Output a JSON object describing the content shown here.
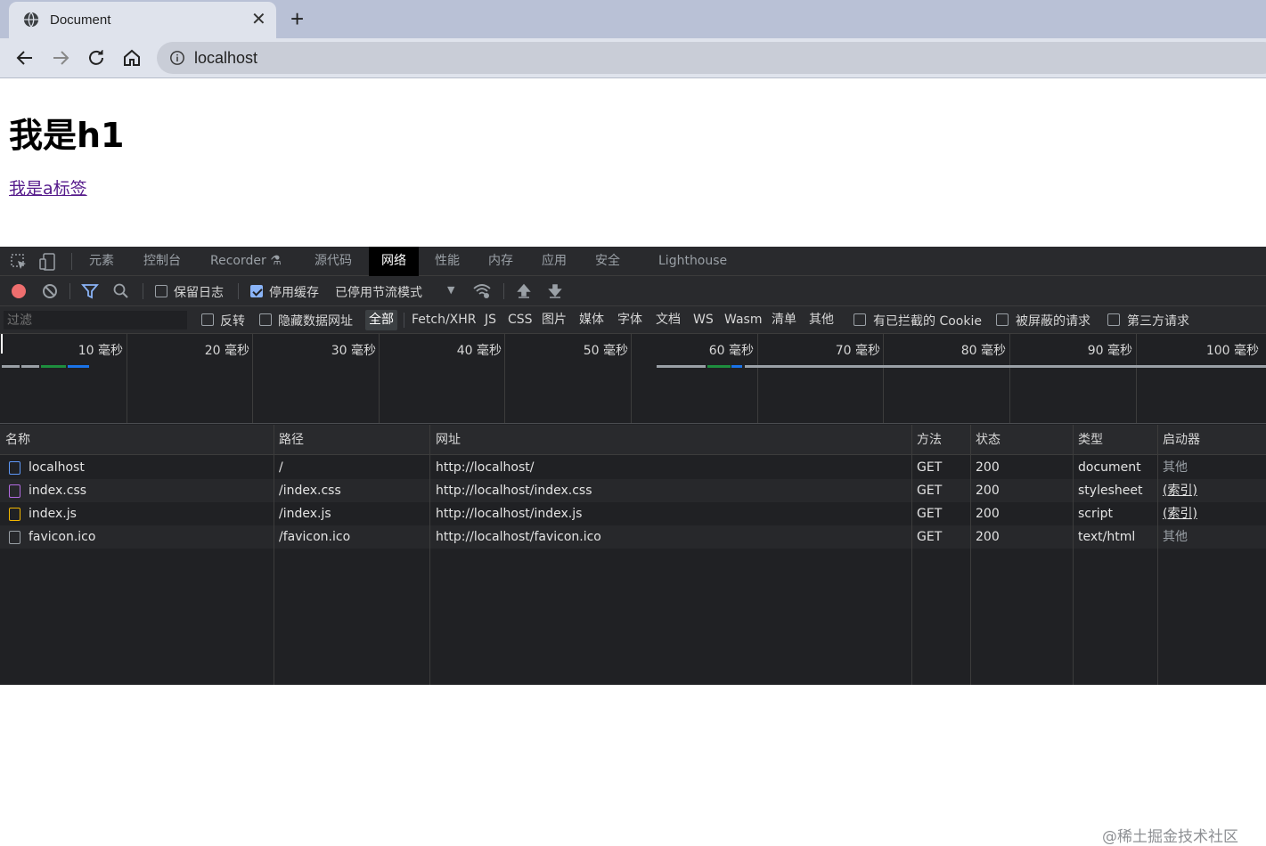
{
  "browser": {
    "tab_title": "Document",
    "tab_close": "✕",
    "new_tab": "+",
    "url": "localhost"
  },
  "page": {
    "heading": "我是h1",
    "link": "我是a标签"
  },
  "devtools": {
    "tabs": [
      "元素",
      "控制台",
      "Recorder ⚗",
      "源代码",
      "网络",
      "性能",
      "内存",
      "应用",
      "安全",
      "Lighthouse"
    ],
    "active_tab": "网络",
    "toolbar": {
      "preserve_log": "保留日志",
      "disable_cache": "停用缓存",
      "throttle": "已停用节流模式",
      "throttle_arrow": "▼"
    },
    "filter": {
      "placeholder": "过滤",
      "invert": "反转",
      "hide_data_urls": "隐藏数据网址",
      "types": [
        "全部",
        "Fetch/XHR",
        "JS",
        "CSS",
        "图片",
        "媒体",
        "字体",
        "文档",
        "WS",
        "Wasm",
        "清单",
        "其他"
      ],
      "active_type": "全部",
      "blocked_cookies": "有已拦截的 Cookie",
      "blocked_requests": "被屏蔽的请求",
      "third_party": "第三方请求"
    },
    "timeline_ticks": [
      "10 毫秒",
      "20 毫秒",
      "30 毫秒",
      "40 毫秒",
      "50 毫秒",
      "60 毫秒",
      "70 毫秒",
      "80 毫秒",
      "90 毫秒",
      "100 毫秒"
    ],
    "table": {
      "headers": [
        "名称",
        "路径",
        "网址",
        "方法",
        "状态",
        "类型",
        "启动器"
      ],
      "rows": [
        {
          "name": "localhost",
          "path": "/",
          "url": "http://localhost/",
          "method": "GET",
          "status": "200",
          "type": "document",
          "initiator": "其他",
          "icon": "document-icon",
          "icon_color": "#5e97f6"
        },
        {
          "name": "index.css",
          "path": "/index.css",
          "url": "http://localhost/index.css",
          "method": "GET",
          "status": "200",
          "type": "stylesheet",
          "initiator": "(索引)",
          "icon": "stylesheet-icon",
          "icon_color": "#b26be0"
        },
        {
          "name": "index.js",
          "path": "/index.js",
          "url": "http://localhost/index.js",
          "method": "GET",
          "status": "200",
          "type": "script",
          "initiator": "(索引)",
          "icon": "script-icon",
          "icon_color": "#f2b600"
        },
        {
          "name": "favicon.ico",
          "path": "/favicon.ico",
          "url": "http://localhost/favicon.ico",
          "method": "GET",
          "status": "200",
          "type": "text/html",
          "initiator": "其他",
          "icon": "file-icon",
          "icon_color": "#9aa0a6"
        }
      ]
    },
    "watermark": "@稀土掘金技术社区"
  }
}
